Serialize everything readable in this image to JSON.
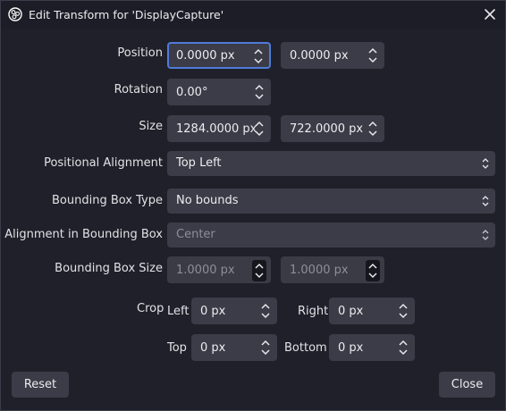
{
  "window": {
    "title": "Edit Transform for 'DisplayCapture'"
  },
  "labels": {
    "position": "Position",
    "rotation": "Rotation",
    "size": "Size",
    "positional_alignment": "Positional Alignment",
    "bounding_box_type": "Bounding Box Type",
    "alignment_in_bounding_box": "Alignment in Bounding Box",
    "bounding_box_size": "Bounding Box Size",
    "crop": "Crop",
    "left": "Left",
    "right": "Right",
    "top": "Top",
    "bottom": "Bottom"
  },
  "fields": {
    "position_x": "0.0000 px",
    "position_y": "0.0000 px",
    "rotation": "0.00°",
    "size_w": "1284.0000 px",
    "size_h": "722.0000 px",
    "positional_alignment": "Top Left",
    "bounding_box_type": "No bounds",
    "alignment_in_bounding_box": "Center",
    "bounding_box_w": "1.0000 px",
    "bounding_box_h": "1.0000 px",
    "crop_left": "0 px",
    "crop_right": "0 px",
    "crop_top": "0 px",
    "crop_bottom": "0 px"
  },
  "buttons": {
    "reset": "Reset",
    "close": "Close"
  },
  "icons": {
    "app": "obs-logo-icon",
    "close": "close-icon",
    "spin": "spin-arrows-icon",
    "combo": "updown-chevron-icon"
  },
  "colors": {
    "background": "#1f2029",
    "field": "#3b3c47",
    "focus": "#4f7bd9",
    "text": "#ececf0",
    "disabled_text": "#8d8e98"
  }
}
